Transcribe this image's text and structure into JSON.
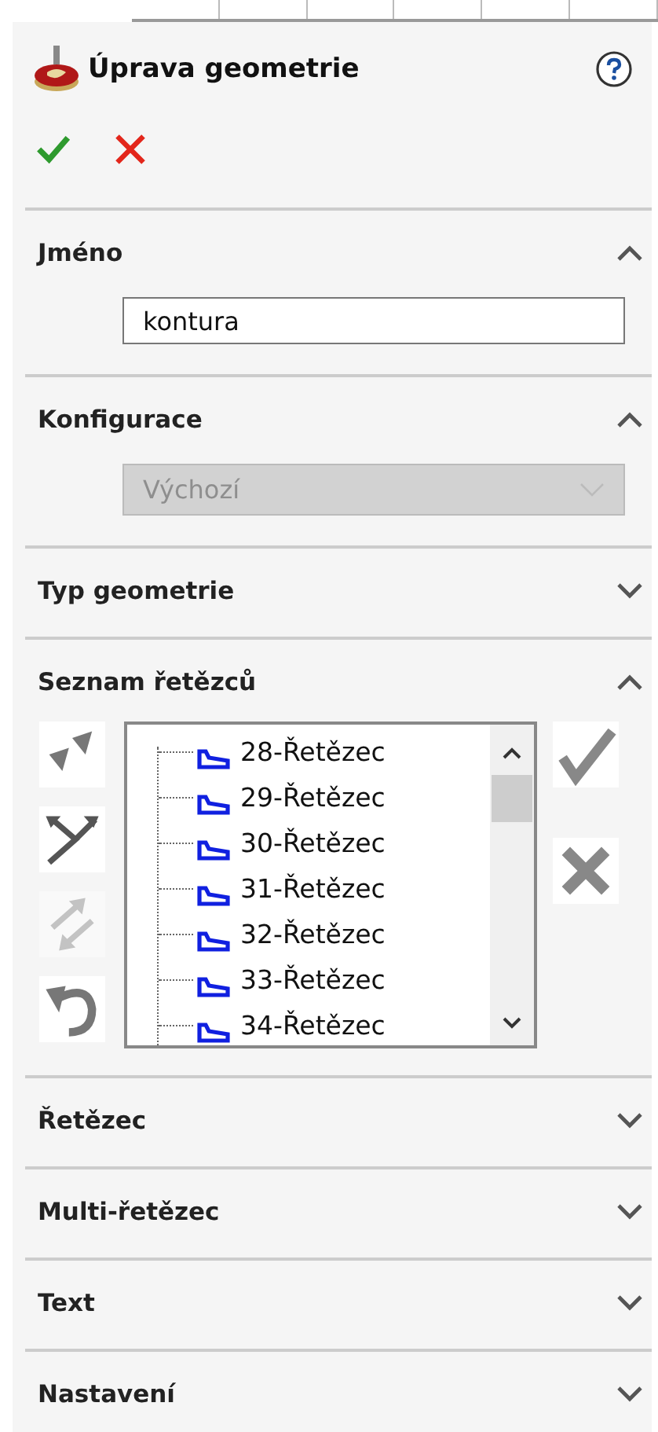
{
  "header": {
    "title": "Úprava geometrie"
  },
  "sections": [
    {
      "title": "Jméno",
      "expanded": true,
      "kind": "text",
      "value": "kontura"
    },
    {
      "title": "Konfigurace",
      "expanded": true,
      "kind": "select",
      "value": "Výchozí",
      "disabled": true
    },
    {
      "title": "Typ geometrie",
      "expanded": false
    },
    {
      "title": "Seznam řetězců",
      "expanded": true,
      "kind": "list",
      "tools": [
        {
          "disabled": false
        },
        {
          "disabled": false
        },
        {
          "disabled": true
        },
        {
          "disabled": false
        }
      ],
      "items": [
        "28-Řetězec",
        "29-Řetězec",
        "30-Řetězec",
        "31-Řetězec",
        "32-Řetězec",
        "33-Řetězec",
        "34-Řetězec"
      ]
    },
    {
      "title": "Řetězec",
      "expanded": false
    },
    {
      "title": "Multi-řetězec",
      "expanded": false
    },
    {
      "title": "Text",
      "expanded": false
    },
    {
      "title": "Nastavení",
      "expanded": false
    }
  ]
}
